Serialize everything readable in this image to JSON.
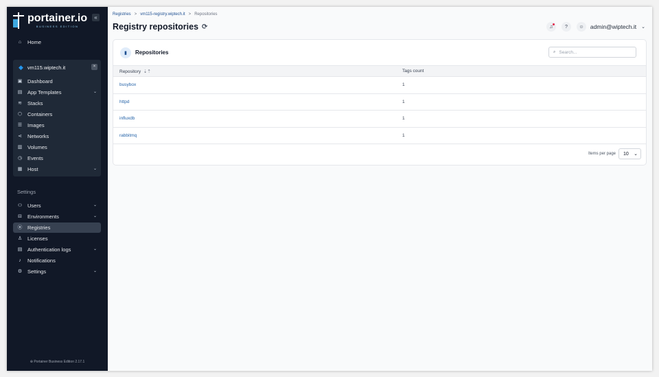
{
  "brand": {
    "name": "portainer.io",
    "edition": "BUSINESS EDITION"
  },
  "sidebar": {
    "home": "Home",
    "environment": {
      "name": "vm115.wiptech.it"
    },
    "env_items": [
      {
        "label": "Dashboard",
        "icon": "dashboard-icon"
      },
      {
        "label": "App Templates",
        "icon": "app-templates-icon"
      },
      {
        "label": "Stacks",
        "icon": "stacks-icon"
      },
      {
        "label": "Containers",
        "icon": "containers-icon"
      },
      {
        "label": "Images",
        "icon": "images-icon"
      },
      {
        "label": "Networks",
        "icon": "networks-icon"
      },
      {
        "label": "Volumes",
        "icon": "volumes-icon"
      },
      {
        "label": "Events",
        "icon": "events-icon"
      },
      {
        "label": "Host",
        "icon": "host-icon"
      }
    ],
    "settings_heading": "Settings",
    "settings_items": [
      {
        "label": "Users",
        "icon": "users-icon"
      },
      {
        "label": "Environments",
        "icon": "environments-icon"
      },
      {
        "label": "Registries",
        "icon": "registries-icon"
      },
      {
        "label": "Licenses",
        "icon": "licenses-icon"
      },
      {
        "label": "Authentication logs",
        "icon": "auth-logs-icon"
      },
      {
        "label": "Notifications",
        "icon": "notifications-icon"
      },
      {
        "label": "Settings",
        "icon": "settings-icon"
      }
    ],
    "footer": "Portainer Business Edition 2.17.1"
  },
  "breadcrumb": {
    "items": [
      "Registries",
      "vm115-registry.wiptech.it",
      "Repositories"
    ],
    "separator": ">"
  },
  "page": {
    "title": "Registry repositories"
  },
  "header": {
    "user": "admin@wiptech.it"
  },
  "card": {
    "title": "Repositories",
    "search_placeholder": "Search...",
    "columns": [
      "Repository",
      "Tags count"
    ],
    "rows": [
      {
        "repository": "busybox",
        "tags": "1"
      },
      {
        "repository": "httpd",
        "tags": "1"
      },
      {
        "repository": "influxdb",
        "tags": "1"
      },
      {
        "repository": "rabbitmq",
        "tags": "1"
      }
    ],
    "items_per_page_label": "Items per page",
    "items_per_page_value": "10"
  },
  "colors": {
    "sidebar_bg": "#111827",
    "accent": "#1d4f91",
    "active_item": "#374151"
  }
}
